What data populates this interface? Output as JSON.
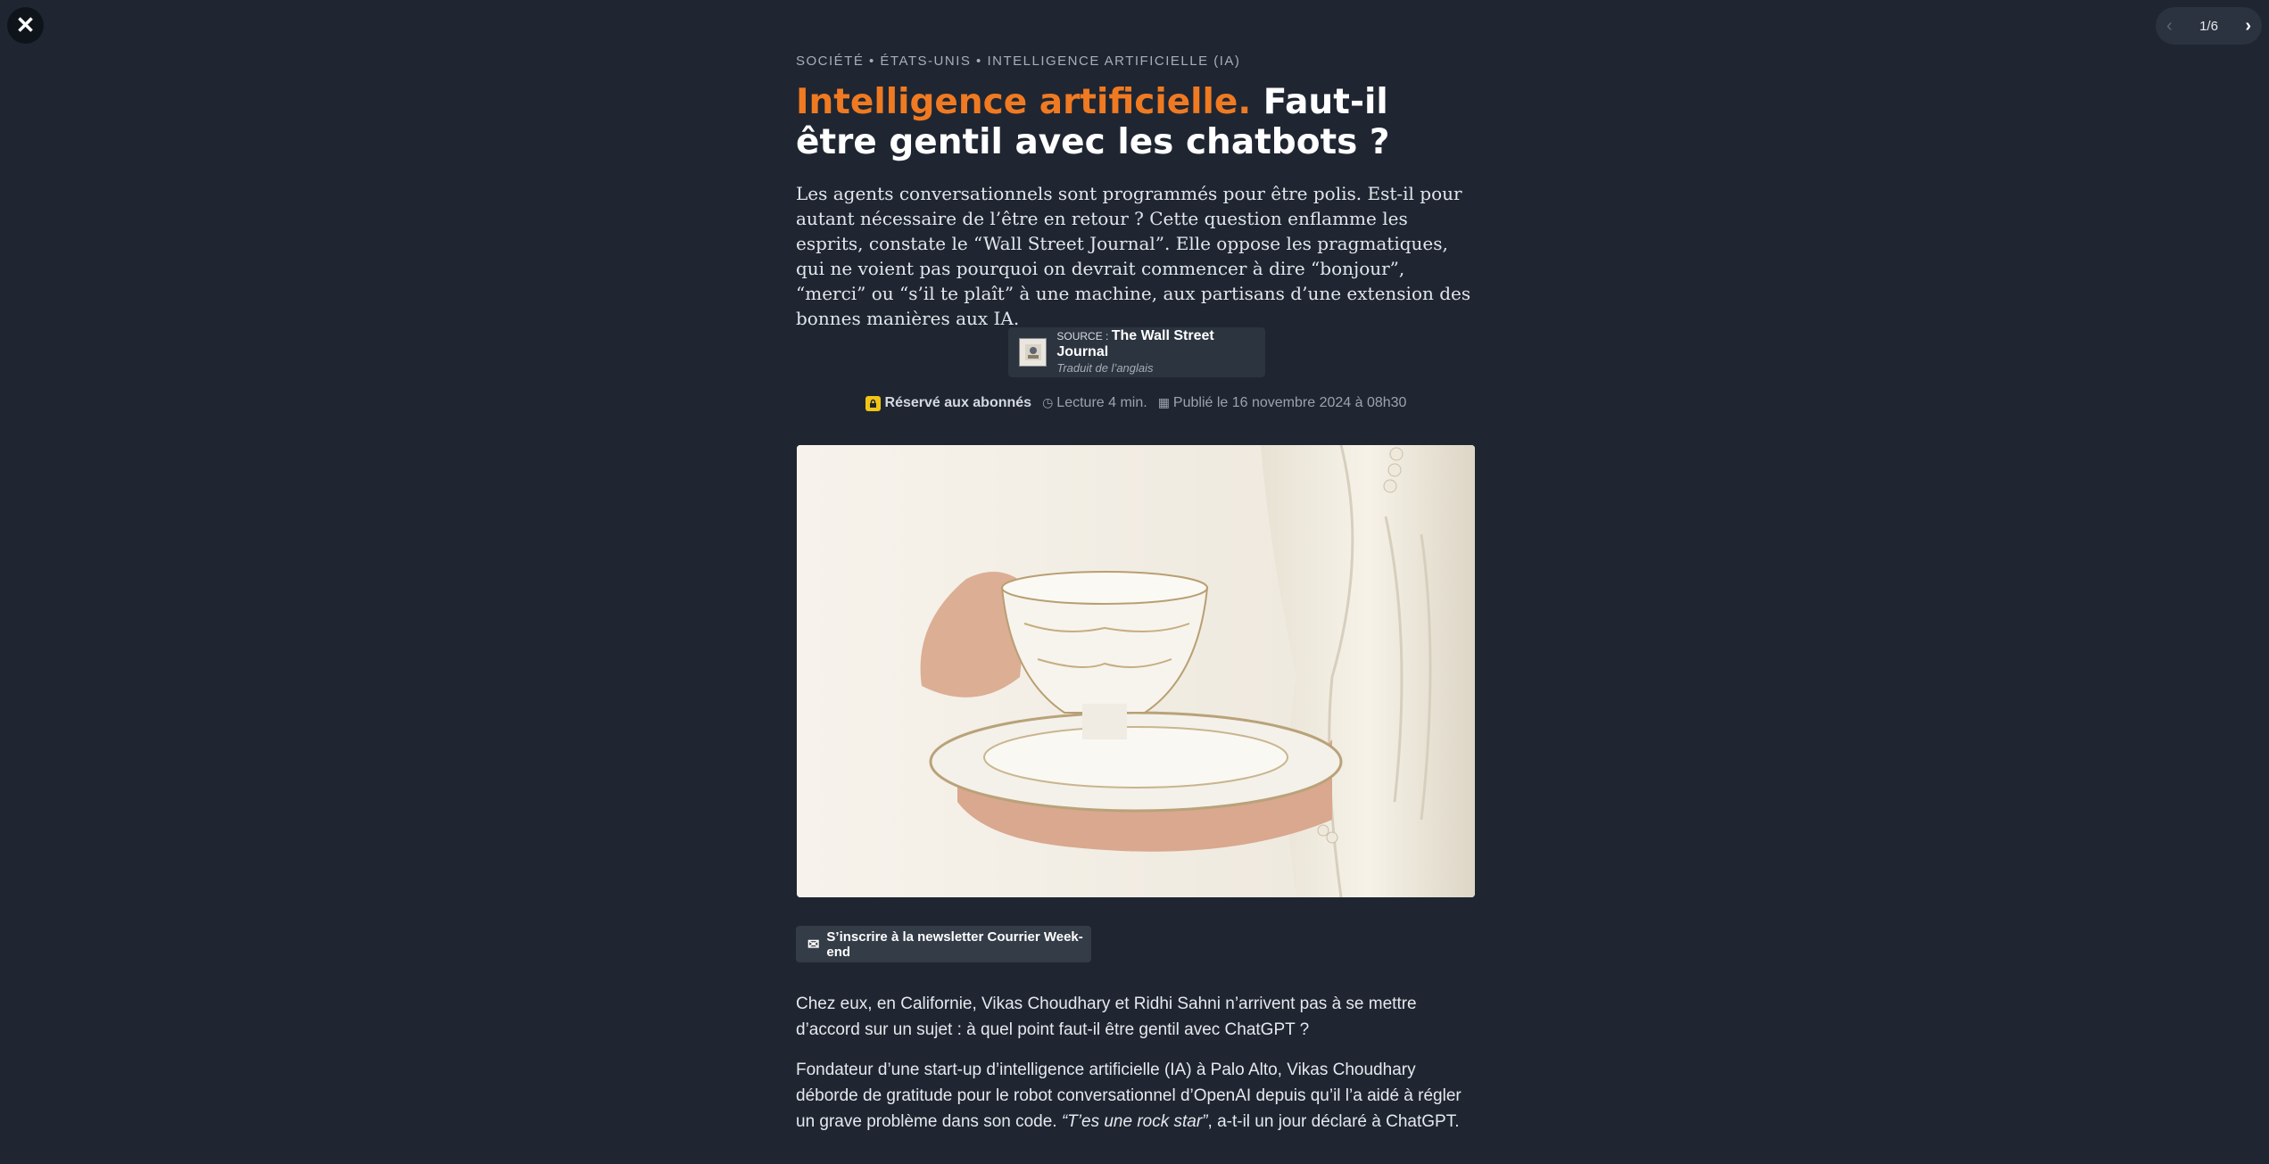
{
  "nav": {
    "close_icon": "close-icon",
    "pager": {
      "text": "1/6",
      "prev_icon": "chevron-left-icon",
      "next_icon": "chevron-right-icon"
    }
  },
  "article": {
    "kicker": "SOCIÉTÉ • ÉTATS-UNIS • INTELLIGENCE ARTIFICIELLE (IA)",
    "headline_accent": "Intelligence artificielle.",
    "headline_rest": " Faut-il être gentil avec les chatbots ?",
    "lede": "Les agents conversationnels sont programmés pour être polis. Est-il pour autant nécessaire de l’être en retour ? Cette question enflamme les esprits, constate le “Wall Street Journal”. Elle oppose les pragmatiques, qui ne voient pas pourquoi on devrait commencer à dire “bonjour”, “merci” ou “s’il te plaît” à une machine, aux partisans d’une extension des bonnes manières aux IA.",
    "source": {
      "prefix": "SOURCE : ",
      "name": "The Wall Street Journal",
      "translated": "Traduit de l’anglais"
    },
    "meta": {
      "subscribers": "Réservé aux abonnés",
      "reading": "Lecture 4 min.",
      "published": "Publié le 16 novembre 2024 à 08h30"
    },
    "newsletter_label": "S’inscrire à la newsletter Courrier Week-end",
    "paragraph1": "Chez eux, en Californie, Vikas Choudhary et Ridhi Sahni n’arrivent pas à se mettre d’accord sur un sujet : à quel point faut-il être gentil avec ChatGPT ?",
    "paragraph2_start": "Fondateur d’une start-up d’intelligence artificielle (IA) à Palo Alto, Vikas Choudhary déborde de gratitude pour le robot conversationnel d’OpenAI depuis qu’il l’a aidé à régler un grave problème dans son code. ",
    "paragraph2_quote": "“T’es une rock star”",
    "paragraph2_end": ", a-t-il un jour déclaré à ChatGPT."
  },
  "colors": {
    "background": "#1f2632",
    "accent": "#f07a21",
    "lock": "#f2c515"
  }
}
